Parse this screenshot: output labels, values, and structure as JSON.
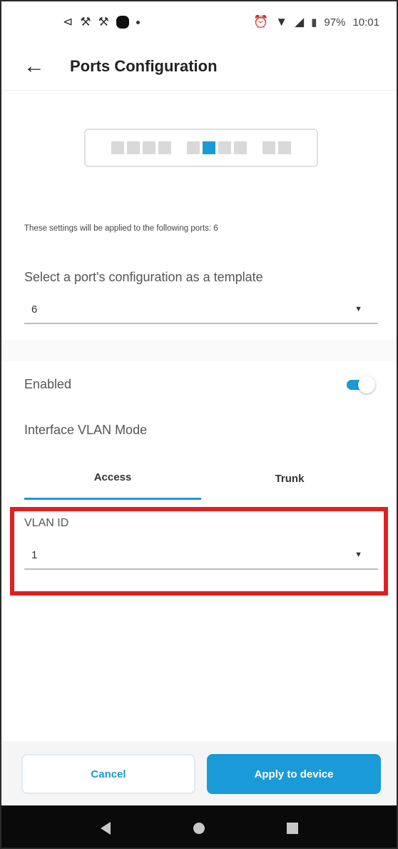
{
  "status_bar": {
    "left_icons": [
      "notification-icon",
      "crossed-tools-icon",
      "crossed-tools-icon",
      "app-icon",
      "more-dot-icon"
    ],
    "right_icons": [
      "alarm-icon",
      "wifi-icon",
      "signal-icon",
      "battery-icon"
    ],
    "battery": "97%",
    "time": "10:01"
  },
  "header": {
    "back_icon": "←",
    "title": "Ports Configuration"
  },
  "ports": {
    "groups": [
      [
        false,
        false,
        false,
        false
      ],
      [
        false,
        true,
        false,
        false
      ],
      [
        false,
        false
      ]
    ],
    "selected_color": "#1a9ad6"
  },
  "applied_text": "These settings will be applied to the following ports: 6",
  "template": {
    "label": "Select a port's configuration as a template",
    "value": "6"
  },
  "enabled": {
    "label": "Enabled",
    "on": true
  },
  "vlan_mode": {
    "label": "Interface VLAN Mode",
    "tabs": [
      {
        "label": "Access",
        "active": true
      },
      {
        "label": "Trunk",
        "active": false
      }
    ]
  },
  "vlan_id": {
    "label": "VLAN ID",
    "value": "1"
  },
  "actions": {
    "cancel": "Cancel",
    "apply": "Apply to device"
  },
  "colors": {
    "accent": "#1a9ad6",
    "highlight": "#e02020"
  }
}
